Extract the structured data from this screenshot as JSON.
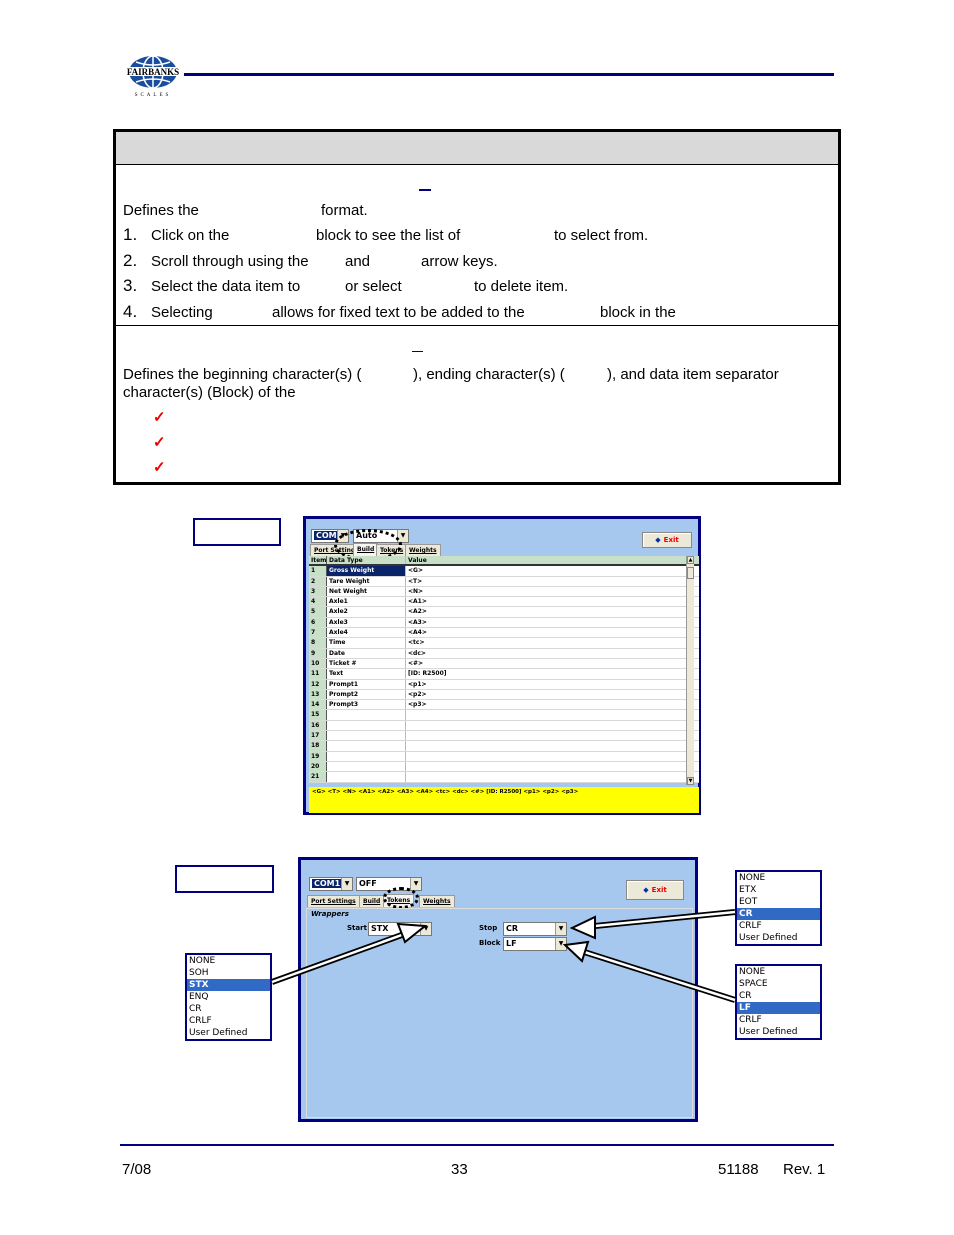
{
  "header": {
    "logo": {
      "name": "FAIRBANKS",
      "subtitle": "SCALES"
    }
  },
  "table": {
    "section1": {
      "intro": [
        "Defines the",
        "format."
      ],
      "steps": [
        {
          "num": "1.",
          "parts": [
            "Click on the",
            "block to see the list of",
            "to select from."
          ]
        },
        {
          "num": "2.",
          "parts": [
            "Scroll through using the",
            "and",
            "arrow keys."
          ]
        },
        {
          "num": "3.",
          "parts": [
            "Select the data item to",
            "or select",
            "to delete item."
          ]
        },
        {
          "num": "4.",
          "parts": [
            "Selecting",
            "allows for fixed text to be added to the",
            "block in the"
          ]
        }
      ]
    },
    "section2": {
      "line1": [
        "Defines the beginning character(s) (",
        "), ending character(s) (",
        "), and data item separator"
      ],
      "line2": "character(s) (Block) of the",
      "checks": [
        "✓",
        "✓",
        "✓"
      ]
    }
  },
  "build_window": {
    "port": "COM4",
    "mode": "Auto",
    "exit_label": "Exit",
    "tabs": [
      "Port Settings",
      "Build",
      "Tokens",
      "Weights"
    ],
    "active_tab": "Build",
    "columns": [
      "Item",
      "Data Type",
      "Value"
    ],
    "rows": [
      {
        "item": "1",
        "type": "Gross Weight",
        "value": "<G>",
        "selected": true
      },
      {
        "item": "2",
        "type": "Tare Weight",
        "value": "<T>"
      },
      {
        "item": "3",
        "type": "Net Weight",
        "value": "<N>"
      },
      {
        "item": "4",
        "type": "Axle1",
        "value": "<A1>"
      },
      {
        "item": "5",
        "type": "Axle2",
        "value": "<A2>"
      },
      {
        "item": "6",
        "type": "Axle3",
        "value": "<A3>"
      },
      {
        "item": "7",
        "type": "Axle4",
        "value": "<A4>"
      },
      {
        "item": "8",
        "type": "Time",
        "value": "<tc>"
      },
      {
        "item": "9",
        "type": "Date",
        "value": "<dc>"
      },
      {
        "item": "10",
        "type": "Ticket #",
        "value": "<#>"
      },
      {
        "item": "11",
        "type": "Text",
        "value": "[ID: R2500]"
      },
      {
        "item": "12",
        "type": "Prompt1",
        "value": "<p1>"
      },
      {
        "item": "13",
        "type": "Prompt2",
        "value": "<p2>"
      },
      {
        "item": "14",
        "type": "Prompt3",
        "value": "<p3>"
      },
      {
        "item": "15",
        "type": "",
        "value": ""
      },
      {
        "item": "16",
        "type": "",
        "value": ""
      },
      {
        "item": "17",
        "type": "",
        "value": ""
      },
      {
        "item": "18",
        "type": "",
        "value": ""
      },
      {
        "item": "19",
        "type": "",
        "value": ""
      },
      {
        "item": "20",
        "type": "",
        "value": ""
      },
      {
        "item": "21",
        "type": "",
        "value": ""
      }
    ],
    "preview": "<G> <T> <N> <A1> <A2> <A3> <A4> <tc> <dc> <#> [ID: R2500] <p1> <p2> <p3>"
  },
  "tokens_window": {
    "port": "COM1",
    "mode": "OFF",
    "exit_label": "Exit",
    "tabs": [
      "Port Settings",
      "Build",
      "Tokens",
      "Weights"
    ],
    "active_tab": "Tokens",
    "group_label": "Wrappers",
    "start_label": "Start",
    "start_value": "STX",
    "stop_label": "Stop",
    "stop_value": "CR",
    "block_label": "Block",
    "block_value": "LF"
  },
  "dropdowns": {
    "start": {
      "options": [
        "NONE",
        "SOH",
        "STX",
        "ENQ",
        "CR",
        "CRLF",
        "User Defined"
      ],
      "selected": "STX"
    },
    "stop": {
      "options": [
        "NONE",
        "ETX",
        "EOT",
        "CR",
        "CRLF",
        "User Defined"
      ],
      "selected": "CR"
    },
    "block": {
      "options": [
        "NONE",
        "SPACE",
        "CR",
        "LF",
        "CRLF",
        "User Defined"
      ],
      "selected": "LF"
    }
  },
  "footer": {
    "date": "7/08",
    "page": "33",
    "doc_number": "51188",
    "revision": "Rev. 1"
  },
  "colors": {
    "accent": "#000080",
    "window_bg": "#a6c8ef",
    "selection": "#316ac5",
    "preview_bg": "#ffff00",
    "check": "#e00000"
  }
}
